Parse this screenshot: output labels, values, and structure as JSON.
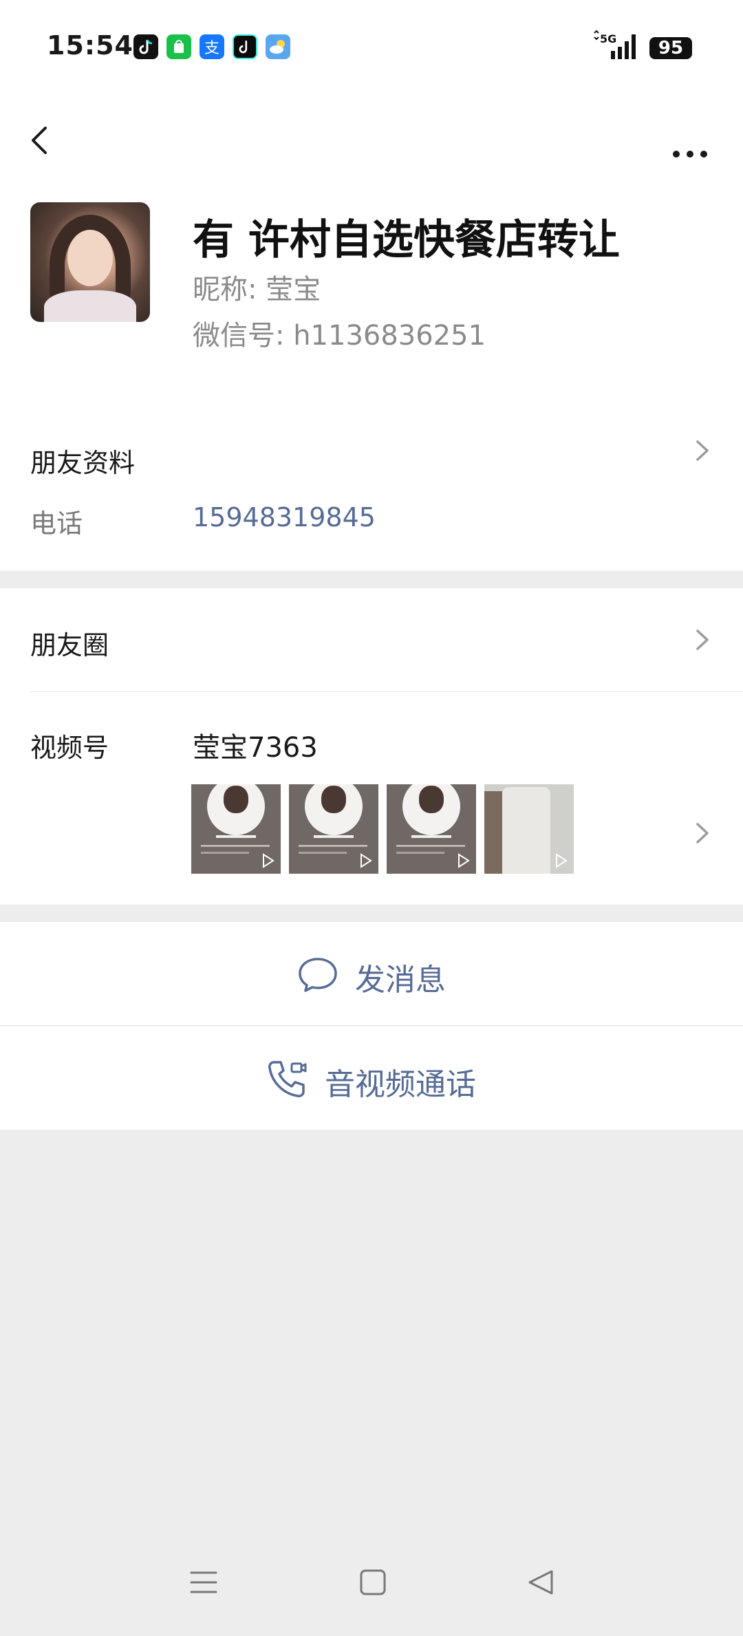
{
  "status_bar": {
    "time": "15:54",
    "network": "5G",
    "battery": "95"
  },
  "profile": {
    "name": "有 许村自选快餐店转让",
    "nickname": "昵称:  莹宝",
    "wechat_id": "微信号:  h1136836251"
  },
  "friend_info": {
    "title": "朋友资料",
    "phone_label": "电话",
    "phone_value": "15948319845"
  },
  "moments": {
    "title": "朋友圈"
  },
  "channels": {
    "title": "视频号",
    "name": "莹宝7363"
  },
  "actions": {
    "message": "发消息",
    "call": "音视频通话"
  },
  "colors": {
    "link": "#576b95",
    "background": "#ededed"
  }
}
